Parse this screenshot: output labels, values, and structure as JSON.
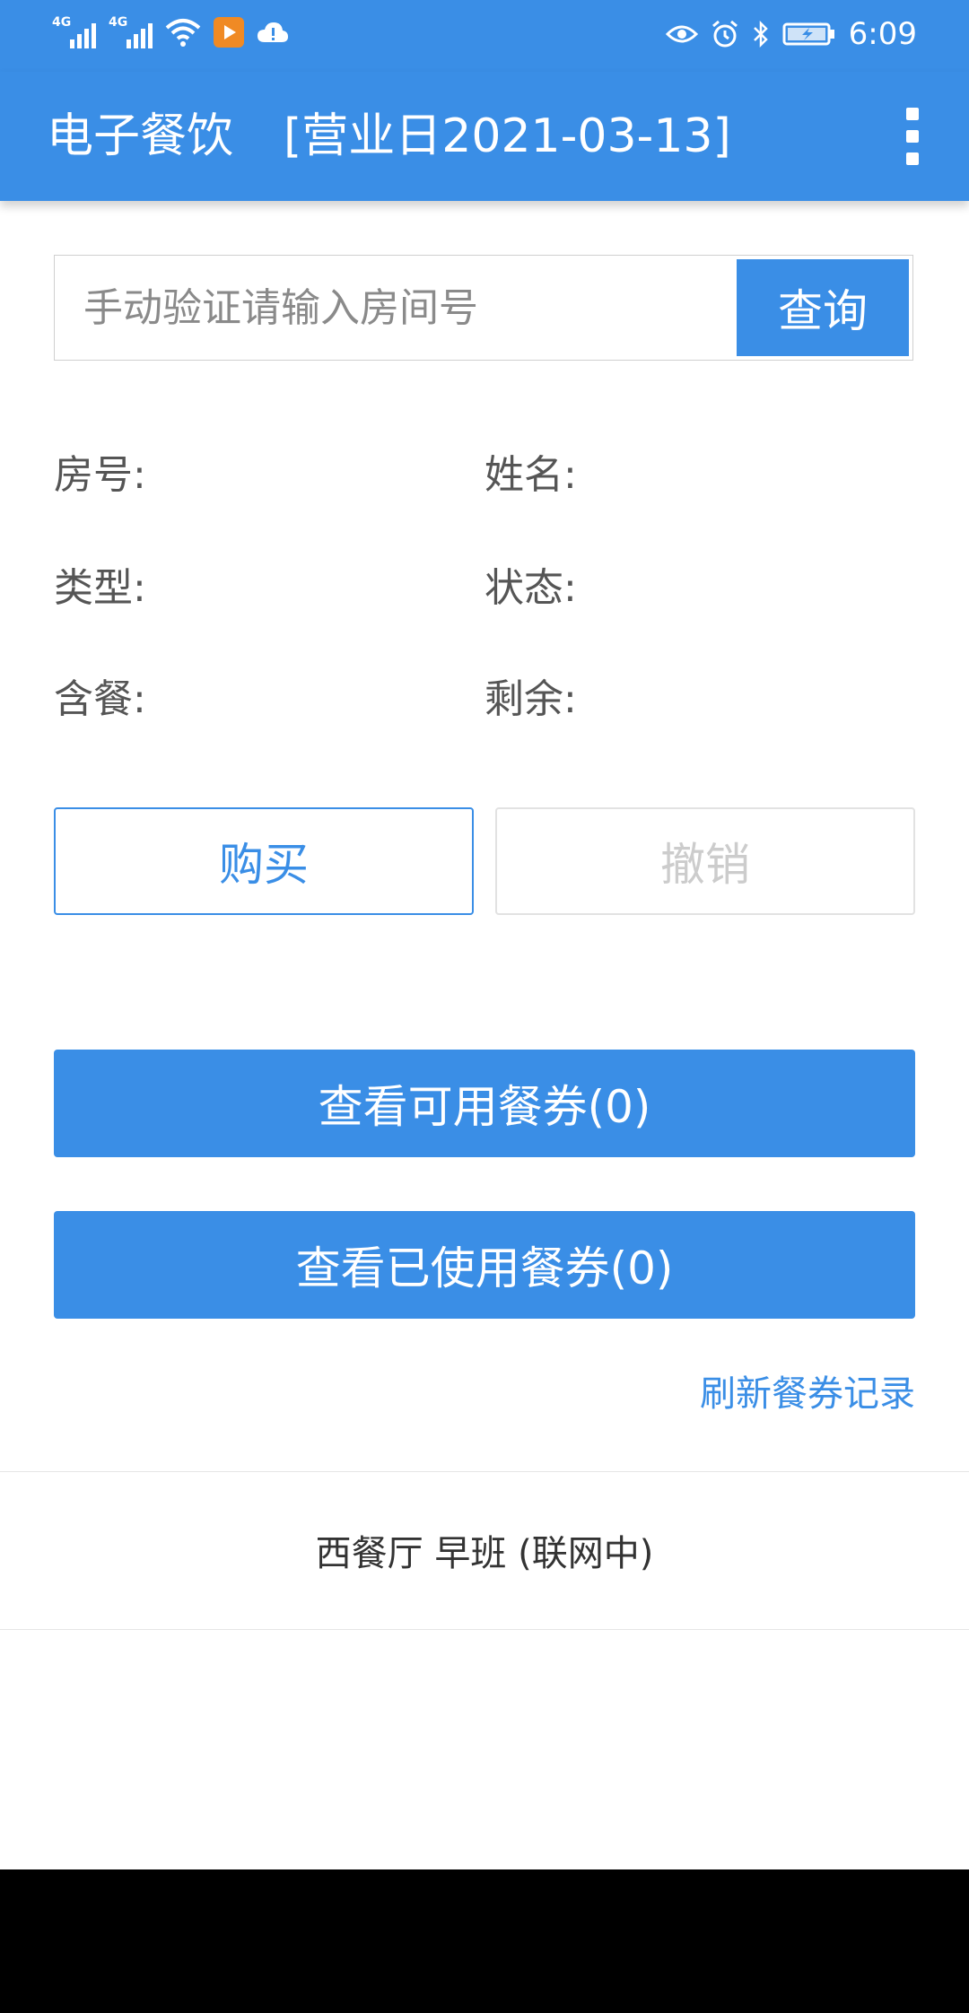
{
  "status_bar": {
    "sim1": "4G",
    "sim2": "4G",
    "icons": [
      "signal-icon",
      "signal-icon",
      "wifi-icon",
      "video-app-icon",
      "cloud-icon",
      "eye-icon",
      "alarm-icon",
      "bluetooth-icon",
      "battery-icon"
    ],
    "time": "6:09"
  },
  "app_bar": {
    "title": "电子餐饮",
    "business_date": "[营业日2021-03-13]"
  },
  "search": {
    "placeholder": "手动验证请输入房间号",
    "value": "",
    "button_label": "查询"
  },
  "info": {
    "room_label": "房号:",
    "name_label": "姓名:",
    "type_label": "类型:",
    "status_label": "状态:",
    "meal_included_label": "含餐:",
    "remaining_label": "剩余:"
  },
  "actions": {
    "buy_label": "购买",
    "cancel_label": "撤销"
  },
  "vouchers": {
    "available_label": "查看可用餐券(0)",
    "used_label": "查看已使用餐券(0)",
    "refresh_label": "刷新餐券记录"
  },
  "footer": {
    "status_text": "西餐厅 早班 (联网中)"
  },
  "colors": {
    "primary": "#3a8ee6",
    "disabled_text": "#cccccc"
  }
}
